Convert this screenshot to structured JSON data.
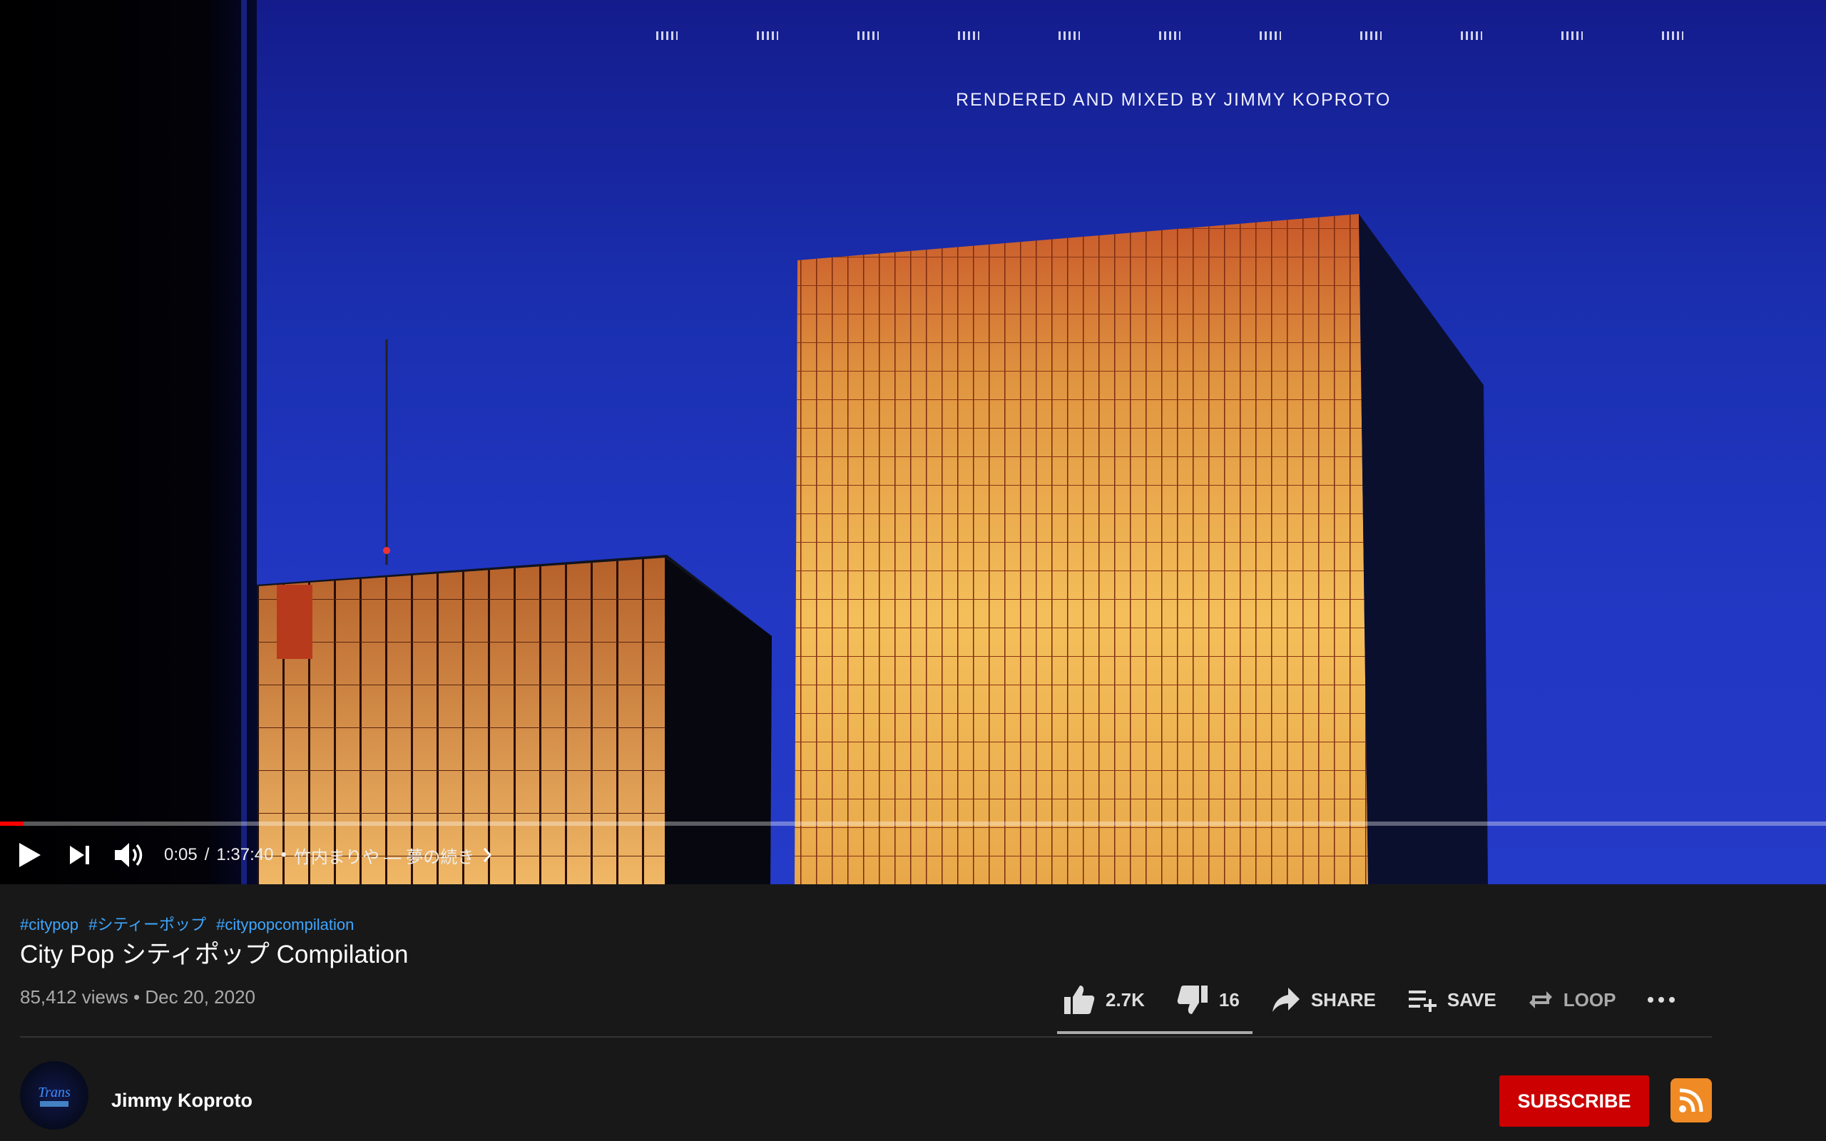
{
  "player": {
    "credit": "RENDERED AND MIXED BY JIMMY KOPROTO",
    "current_time": "0:05",
    "separator": "/",
    "duration": "1:37:40",
    "bullet": "•",
    "chapter": "竹内まりや — 夢の続き",
    "progress_fraction": 0.0009,
    "buffered_fraction": 0.013
  },
  "video": {
    "hashtags": [
      "#citypop",
      "#シティーポップ",
      "#citypopcompilation"
    ],
    "title": "City Pop シティポップ Compilation",
    "views": "85,412 views",
    "dot": "•",
    "date": "Dec 20, 2020"
  },
  "actions": {
    "like_count": "2.7K",
    "dislike_count": "16",
    "share_label": "SHARE",
    "save_label": "SAVE",
    "loop_label": "LOOP"
  },
  "channel": {
    "name": "Jimmy Koproto",
    "subscribe_label": "SUBSCRIBE"
  },
  "colors": {
    "accent_red": "#cc0000",
    "link_blue": "#3ea6ff",
    "rss_orange": "#f08a24"
  }
}
